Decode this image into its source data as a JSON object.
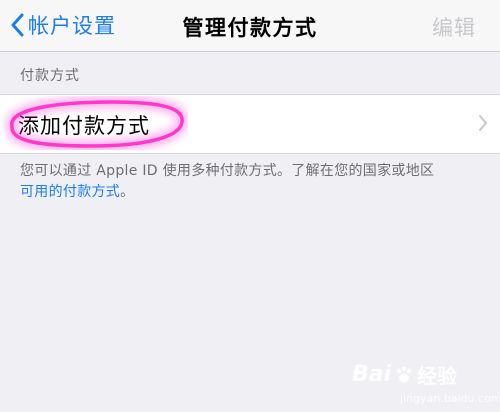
{
  "nav": {
    "back_label": "帐户设置",
    "title": "管理付款方式",
    "edit_label": "编辑"
  },
  "section": {
    "header": "付款方式"
  },
  "row": {
    "label": "添加付款方式",
    "chevron_icon": "chevron-right-icon"
  },
  "footer": {
    "text": "您可以通过 Apple ID 使用多种付款方式。了解在您的国家或地区",
    "link": "可用的付款方式",
    "suffix": "。"
  },
  "watermark": {
    "brand": "Bai",
    "brand_suffix": "经验",
    "url": "jingyan.baidu.com"
  },
  "colors": {
    "accent": "#1b7cf0",
    "background": "#efeff4",
    "highlight": "#ff2fc8",
    "disabled": "#c8c8cc"
  }
}
